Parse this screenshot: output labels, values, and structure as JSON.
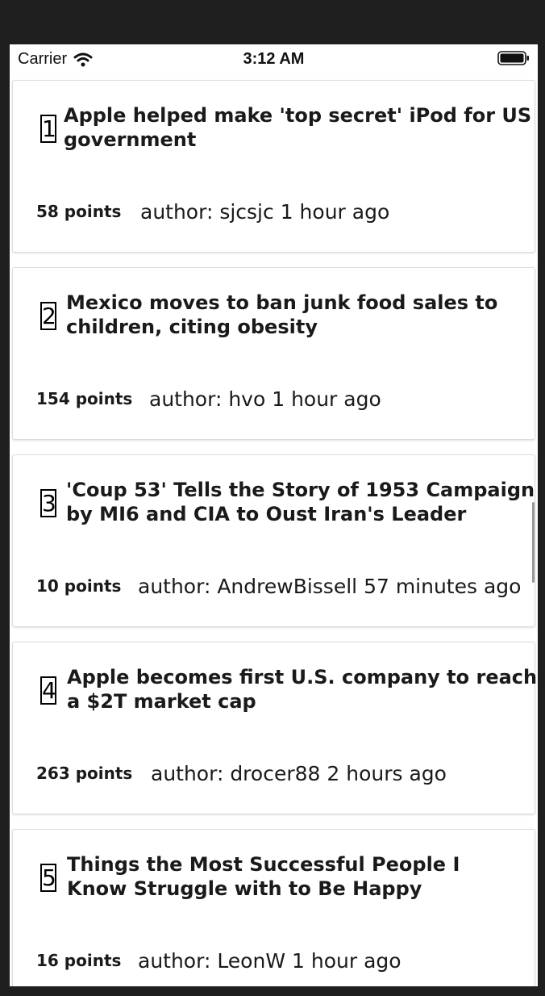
{
  "status_bar": {
    "carrier": "Carrier",
    "time": "3:12 AM"
  },
  "stories": [
    {
      "rank": "1",
      "title": "Apple helped make 'top secret' iPod for US government",
      "points": "58 points",
      "author": "author: sjcsjc",
      "age": "1 hour ago"
    },
    {
      "rank": "2",
      "title": "Mexico moves to ban junk food sales to children, citing obesity",
      "points": "154 points",
      "author": "author: hvo",
      "age": "1 hour ago"
    },
    {
      "rank": "3",
      "title": "'Coup 53' Tells the Story of 1953 Campaign by MI6 and CIA to Oust Iran's Leader",
      "points": "10 points",
      "author": "author: AndrewBissell",
      "age": "57 minutes ago"
    },
    {
      "rank": "4",
      "title": "Apple becomes first U.S. company to reach a $2T market cap",
      "points": "263 points",
      "author": "author: drocer88",
      "age": "2 hours ago"
    },
    {
      "rank": "5",
      "title": "Things the Most Successful People I Know Struggle with to Be Happy",
      "points": "16 points",
      "author": "author: LeonW",
      "age": "1 hour ago"
    }
  ]
}
